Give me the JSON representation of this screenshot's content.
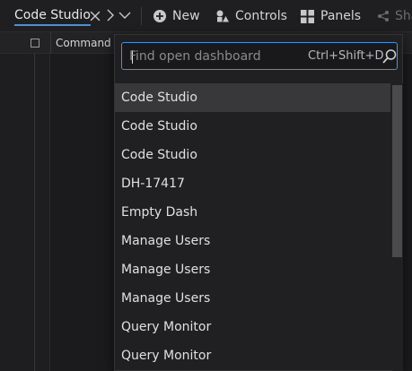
{
  "toolbar": {
    "tab_title": "Code Studio",
    "new_label": "New",
    "controls_label": "Controls",
    "panels_label": "Panels",
    "share_label": "Sha"
  },
  "panel": {
    "title": "Command H"
  },
  "finder": {
    "placeholder": "Find open dashboard",
    "shortcut": "Ctrl+Shift+D",
    "items": [
      {
        "label": "Code Studio"
      },
      {
        "label": "Code Studio"
      },
      {
        "label": "Code Studio"
      },
      {
        "label": "DH-17417"
      },
      {
        "label": "Empty Dash"
      },
      {
        "label": "Manage Users"
      },
      {
        "label": "Manage Users"
      },
      {
        "label": "Manage Users"
      },
      {
        "label": "Query Monitor"
      },
      {
        "label": "Query Monitor"
      }
    ]
  },
  "colors": {
    "accent": "#4a90d9",
    "selected_row": "#38383b"
  }
}
